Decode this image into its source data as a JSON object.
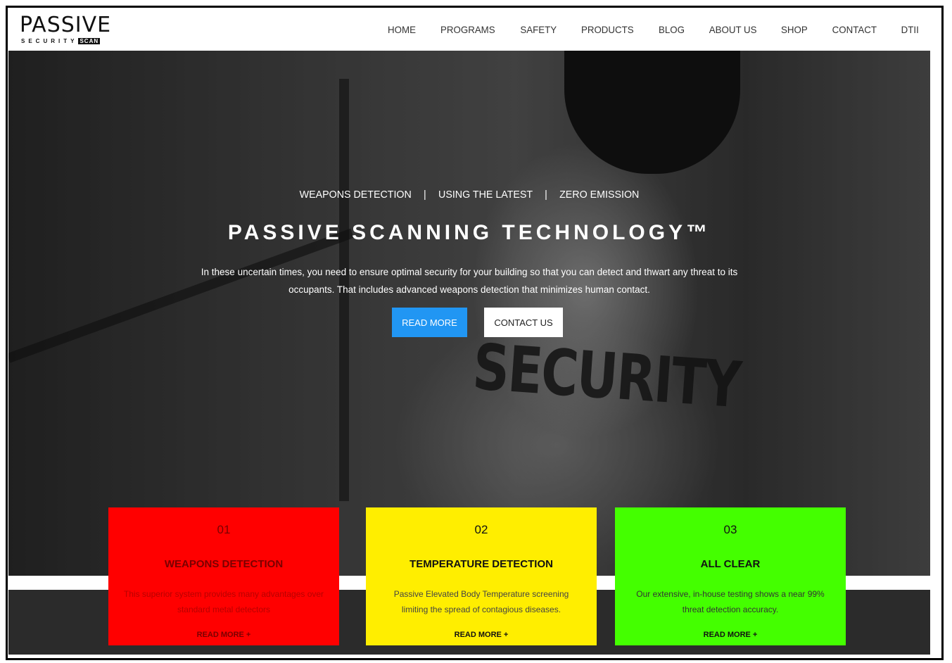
{
  "logo": {
    "word": "PASSIVE",
    "sub": "SECURITY",
    "badge": "SCAN"
  },
  "nav": {
    "items": [
      {
        "label": "HOME"
      },
      {
        "label": "PROGRAMS"
      },
      {
        "label": "SAFETY"
      },
      {
        "label": "PRODUCTS"
      },
      {
        "label": "BLOG"
      },
      {
        "label": "ABOUT US"
      },
      {
        "label": "SHOP"
      },
      {
        "label": "CONTACT"
      },
      {
        "label": "DTII"
      }
    ]
  },
  "hero": {
    "tag1": "WEAPONS DETECTION",
    "tag2": "USING THE LATEST",
    "tag3": "ZERO EMISSION",
    "separator": "|",
    "title": "PASSIVE SCANNING TECHNOLOGY™",
    "description": "In these uncertain times, you need to ensure optimal security for your building so that you can detect and thwart any threat to its occupants. That includes advanced weapons detection that minimizes human contact.",
    "read_more_label": "READ MORE",
    "contact_label": "CONTACT US",
    "shirt_text": "SECURITY"
  },
  "cards": [
    {
      "number": "01",
      "title": "WEAPONS DETECTION",
      "text": "This superior system provides many advantages over standard metal detectors",
      "link": "READ MORE +",
      "bg": "#ff0000",
      "fg": "#7a0000",
      "text_color": "#b80000"
    },
    {
      "number": "02",
      "title": "TEMPERATURE DETECTION",
      "text": "Passive Elevated Body Temperature screening limiting the spread of contagious diseases.",
      "link": "READ MORE +",
      "bg": "#ffee00",
      "fg": "#111111",
      "text_color": "#444444"
    },
    {
      "number": "03",
      "title": "ALL CLEAR",
      "text": "Our extensive, in-house testing shows a near 99% threat detection accuracy.",
      "link": "READ MORE +",
      "bg": "#44ff00",
      "fg": "#111111",
      "text_color": "#333333"
    }
  ],
  "colors": {
    "accent": "#2196f3",
    "dark_band": "#2b2b2b"
  }
}
